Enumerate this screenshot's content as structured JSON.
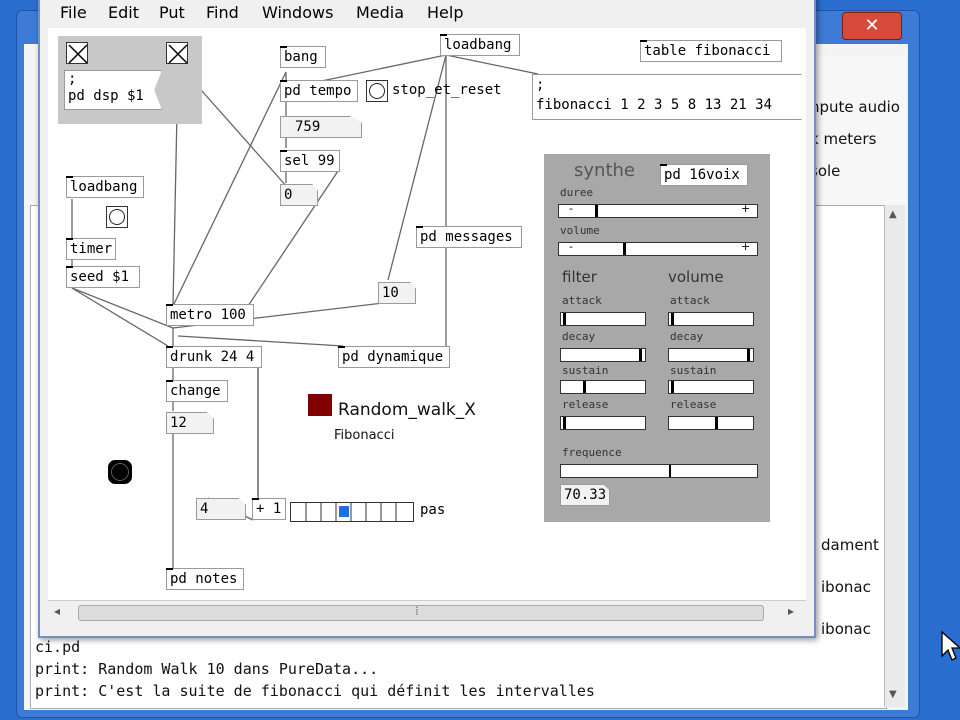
{
  "bg_window": {
    "close_glyph": "✕",
    "side_items": [
      "npute audio",
      "k meters",
      "sole"
    ],
    "console_lines": [
      "ci.pd",
      "print: Random Walk 10 dans PureData...",
      "print: C'est la suite de fibonacci qui définit les intervalles"
    ],
    "right_fragments": [
      "dament",
      "ibonac",
      "ibonac"
    ]
  },
  "menu": [
    "File",
    "Edit",
    "Put",
    "Find",
    "Windows",
    "Media",
    "Help"
  ],
  "patch": {
    "dsp_msg": ";\npd dsp $1",
    "bang_obj": "bang",
    "pd_tempo": "pd tempo",
    "stop_label": "stop_et_reset",
    "atom_759": "759",
    "sel_99": "sel 99",
    "atom_0": "0",
    "loadbang_top": "loadbang",
    "table_fib": "table fibonacci",
    "fib_msg_line1": ";",
    "fib_msg_line2": "fibonacci 1 2 3 5 8 13 21 34",
    "loadbang_left": "loadbang",
    "timer": "timer",
    "seed": "seed $1",
    "pd_messages": "pd messages",
    "atom_10": "10",
    "metro": "metro 100",
    "drunk": "drunk 24 4",
    "pd_dynamique": "pd dynamique",
    "change": "change",
    "atom_12": "12",
    "canvas_title": "Random_walk_X",
    "canvas_sub": "Fibonacci",
    "atom_4": "4",
    "plus1": "+ 1",
    "pas_label": "pas",
    "pd_notes": "pd notes"
  },
  "synth": {
    "title": "synthe",
    "pd16": "pd 16voix",
    "duree": "duree",
    "volume_label": "volume",
    "minus": "-",
    "plus": "+",
    "filter": "filter",
    "volume": "volume",
    "attack": "attack",
    "decay": "decay",
    "sustain": "sustain",
    "release": "release",
    "frequence": "frequence",
    "freq_value": "70.33"
  },
  "scroll": {
    "thumb_glyph": "⁞",
    "left": "◂",
    "right": "▸"
  },
  "colors": {
    "red_canvas": "#800000",
    "gop_bg": "#a8a8a8",
    "radio_active": "#1e6fe0"
  }
}
